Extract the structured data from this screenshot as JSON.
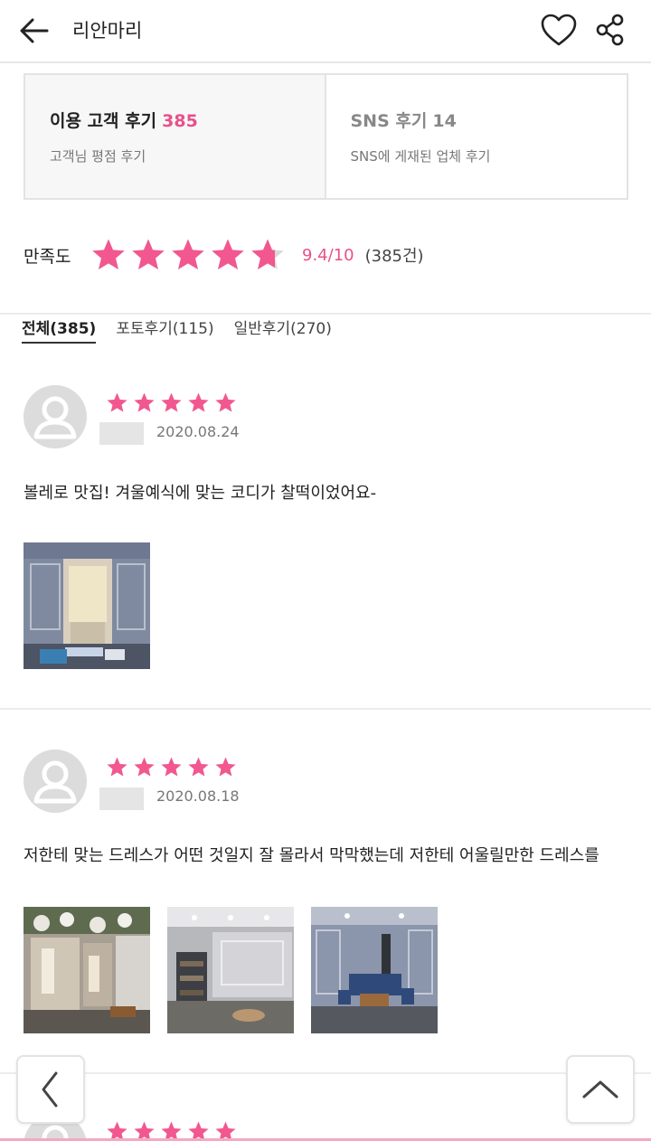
{
  "header": {
    "title": "리안마리",
    "back_icon": "arrow-left-icon",
    "like_icon": "heart-outline-icon",
    "share_icon": "share-icon"
  },
  "review_tabs": [
    {
      "title": "이용 고객 후기",
      "count": "385",
      "subtitle": "고객님 평점 후기",
      "active": true
    },
    {
      "title": "SNS 후기",
      "count": "14",
      "subtitle": "SNS에 게재된 업체 후기",
      "active": false
    }
  ],
  "satisfaction": {
    "label": "만족도",
    "score_text": "9.4/10",
    "count_text": "(385건)",
    "rating": 4.7,
    "max": 5
  },
  "filter_tabs": [
    {
      "label": "전체(385)",
      "active": true
    },
    {
      "label": "포토후기(115)",
      "active": false
    },
    {
      "label": "일반후기(270)",
      "active": false
    }
  ],
  "reviews": [
    {
      "stars": 5,
      "date": "2020.08.24",
      "text": "볼레로 맛집! 겨울예식에 맞는 코디가 찰떡이었어요-",
      "photos": [
        "photo-bridal-room-1"
      ]
    },
    {
      "stars": 5,
      "date": "2020.08.18",
      "text": "저한테 맞는 드레스가 어떤 것일지 잘 몰라서 막막했는데 저한테 어울릴만한 드레스를",
      "photos": [
        "photo-dress-showroom",
        "photo-fitting-room",
        "photo-lounge"
      ]
    },
    {
      "stars": 5
    }
  ],
  "colors": {
    "accent": "#e8508a",
    "star": "#f2578f",
    "star_empty": "#d8d8d8",
    "divider": "#ececec"
  },
  "floating": {
    "prev_icon": "chevron-left-icon",
    "top_icon": "chevron-up-icon"
  }
}
